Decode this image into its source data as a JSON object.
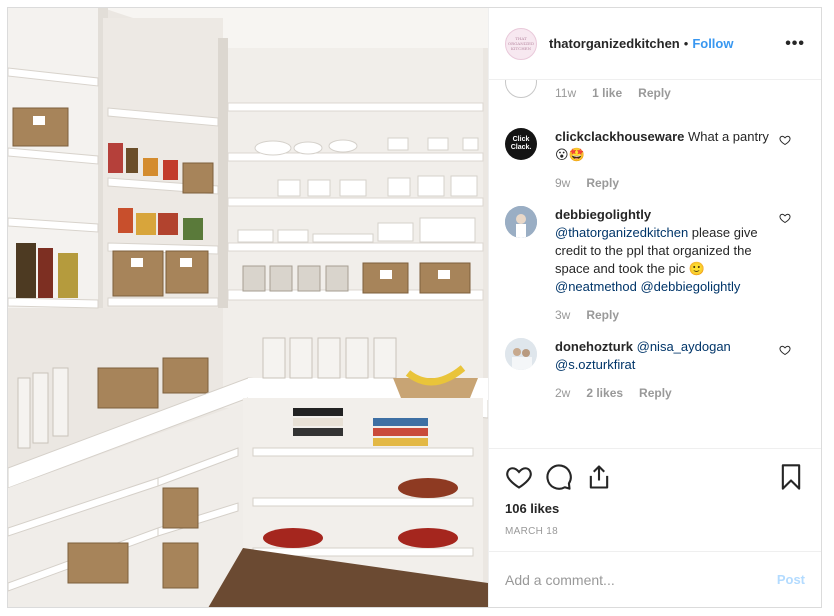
{
  "header": {
    "username": "thatorganizedkitchen",
    "separator": "•",
    "follow_label": "Follow",
    "more_label": "•••",
    "avatar_text": "THAT ORGANIZED KITCHEN"
  },
  "partial_comment": {
    "time": "11w",
    "likes": "1 like",
    "reply": "Reply"
  },
  "comments": [
    {
      "avatar_text": "Click Clack.",
      "username": "clickclackhouseware",
      "text": "What a pantry 😮🤩",
      "time": "9w",
      "reply": "Reply"
    },
    {
      "username": "debbiegolightly",
      "mention1": "@thatorganizedkitchen",
      "text_mid": "please give credit to the ppl that organized the space and took the pic 🙂",
      "mention2": "@neatmethod",
      "mention3": "@debbiegolightly",
      "time": "3w",
      "reply": "Reply"
    },
    {
      "username": "donehozturk",
      "mention1": "@nisa_aydogan",
      "mention2": "@s.ozturkfirat",
      "time": "2w",
      "likes": "2 likes",
      "reply": "Reply"
    }
  ],
  "actions": {
    "likes": "106 likes",
    "date": "MARCH 18"
  },
  "add_comment": {
    "placeholder": "Add a comment...",
    "post_label": "Post"
  },
  "colors": {
    "accent": "#3897f0",
    "mention": "#003569",
    "muted": "#999999",
    "post_disabled": "#b3dbff"
  }
}
